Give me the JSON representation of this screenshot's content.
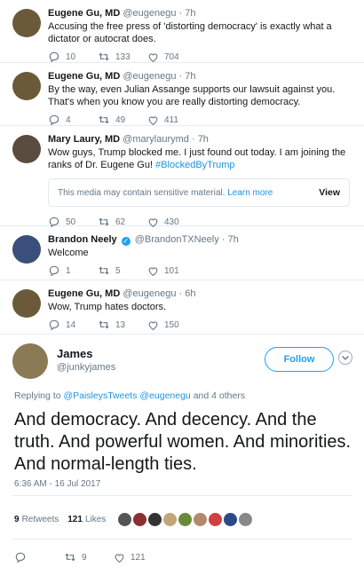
{
  "replies": [
    {
      "name": "Eugene Gu, MD",
      "handle": "@eugenegu",
      "time": "7h",
      "text": "Accusing the free press of 'distorting democracy' is exactly what a dictator or autocrat does.",
      "reply_count": "10",
      "retweet_count": "133",
      "like_count": "704",
      "avatar_color": "#6b5a3a"
    },
    {
      "name": "Eugene Gu, MD",
      "handle": "@eugenegu",
      "time": "7h",
      "text": "By the way, even Julian Assange supports our lawsuit against you. That's when you know you are really distorting democracy.",
      "reply_count": "4",
      "retweet_count": "49",
      "like_count": "411",
      "avatar_color": "#6b5a3a"
    },
    {
      "name": "Mary Laury, MD",
      "handle": "@marylaurymd",
      "time": "7h",
      "text_main": "Wow guys, Trump blocked me. I just found out today. I am joining the ranks of Dr. Eugene Gu! ",
      "hashtag": "#BlockedByTrump",
      "media_warning": "This media may contain sensitive material.",
      "learn_more": "Learn more",
      "view_label": "View",
      "reply_count": "50",
      "retweet_count": "62",
      "like_count": "430",
      "avatar_color": "#5a4b3f"
    },
    {
      "name": "Brandon Neely",
      "handle": "@BrandonTXNeely",
      "time": "7h",
      "text": "Welcome",
      "reply_count": "1",
      "retweet_count": "5",
      "like_count": "101",
      "avatar_color": "#3a4f7a"
    },
    {
      "name": "Eugene Gu, MD",
      "handle": "@eugenegu",
      "time": "6h",
      "text": "Wow, Trump hates doctors.",
      "reply_count": "14",
      "retweet_count": "13",
      "like_count": "150",
      "avatar_color": "#6b5a3a"
    }
  ],
  "main_tweet": {
    "name": "James",
    "handle": "@junkyjames",
    "follow_label": "Follow",
    "replying_prefix": "Replying to ",
    "replying_users": "@PaisleysTweets @eugenegu",
    "replying_suffix": " and 4 others",
    "text": "And democracy. And decency. And the truth. And powerful women. And minorities. And normal-length ties.",
    "timestamp": "6:36 AM - 16 Jul 2017",
    "retweets_count": "9",
    "retweets_label": "Retweets",
    "likes_count": "121",
    "likes_label": "Likes",
    "reply_count": "",
    "retweet_count": "9",
    "like_count": "121",
    "avatar_color": "#8a7a55",
    "liker_colors": [
      "#555555",
      "#8a3030",
      "#333333",
      "#c4a57a",
      "#6a8a3a",
      "#b08a6a",
      "#d04040",
      "#2a4a8a",
      "#888888"
    ]
  },
  "colors": {
    "accent": "#1da1f2",
    "link": "#1b95e0",
    "muted": "#657786"
  }
}
